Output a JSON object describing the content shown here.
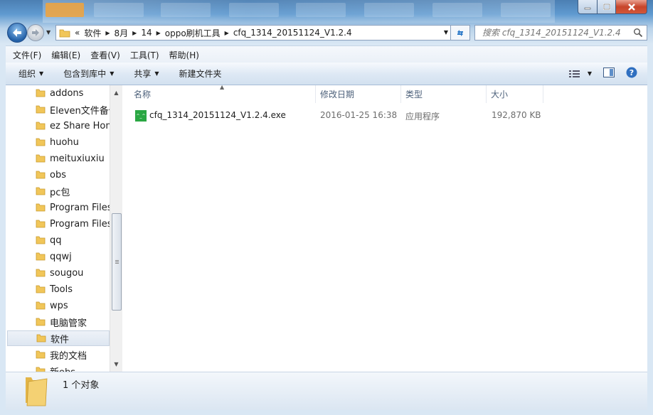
{
  "window": {
    "breadcrumb": [
      "8月",
      "14",
      "oppo刷机工具",
      "cfq_1314_20151124_V1.2.4"
    ],
    "breadcrumb_root": "软件",
    "overflow_chevron": "«",
    "search_placeholder": "搜索 cfq_1314_20151124_V1.2.4"
  },
  "menu": [
    "文件(F)",
    "编辑(E)",
    "查看(V)",
    "工具(T)",
    "帮助(H)"
  ],
  "toolbar": {
    "organize": "组织",
    "include_library": "包含到库中",
    "share": "共享",
    "new_folder": "新建文件夹"
  },
  "tree": [
    {
      "label": "addons"
    },
    {
      "label": "Eleven文件备份"
    },
    {
      "label": "ez Share Home"
    },
    {
      "label": "huohu"
    },
    {
      "label": "meituxiuxiu"
    },
    {
      "label": "obs"
    },
    {
      "label": "pc包"
    },
    {
      "label": "Program Files"
    },
    {
      "label": "Program Files"
    },
    {
      "label": "qq"
    },
    {
      "label": "qqwj"
    },
    {
      "label": "sougou"
    },
    {
      "label": "Tools"
    },
    {
      "label": "wps"
    },
    {
      "label": "电脑管家"
    },
    {
      "label": "软件",
      "selected": true
    },
    {
      "label": "我的文档"
    },
    {
      "label": "新obs"
    }
  ],
  "columns": {
    "name": "名称",
    "modified": "修改日期",
    "type": "类型",
    "size": "大小"
  },
  "files": [
    {
      "name": "cfq_1314_20151124_V1.2.4.exe",
      "modified": "2016-01-25 16:38",
      "type": "应用程序",
      "size": "192,870 KB"
    }
  ],
  "status": {
    "count": "1 个对象"
  },
  "icons": {
    "folder": "folder-icon",
    "exe": "exe-icon",
    "refresh": "refresh-icon",
    "search": "search-icon",
    "help": "help-icon"
  },
  "colors": {
    "accent": "#3a78c0",
    "folder": "#f1c659",
    "exe_green": "#2aa743",
    "close": "#c7442b"
  }
}
